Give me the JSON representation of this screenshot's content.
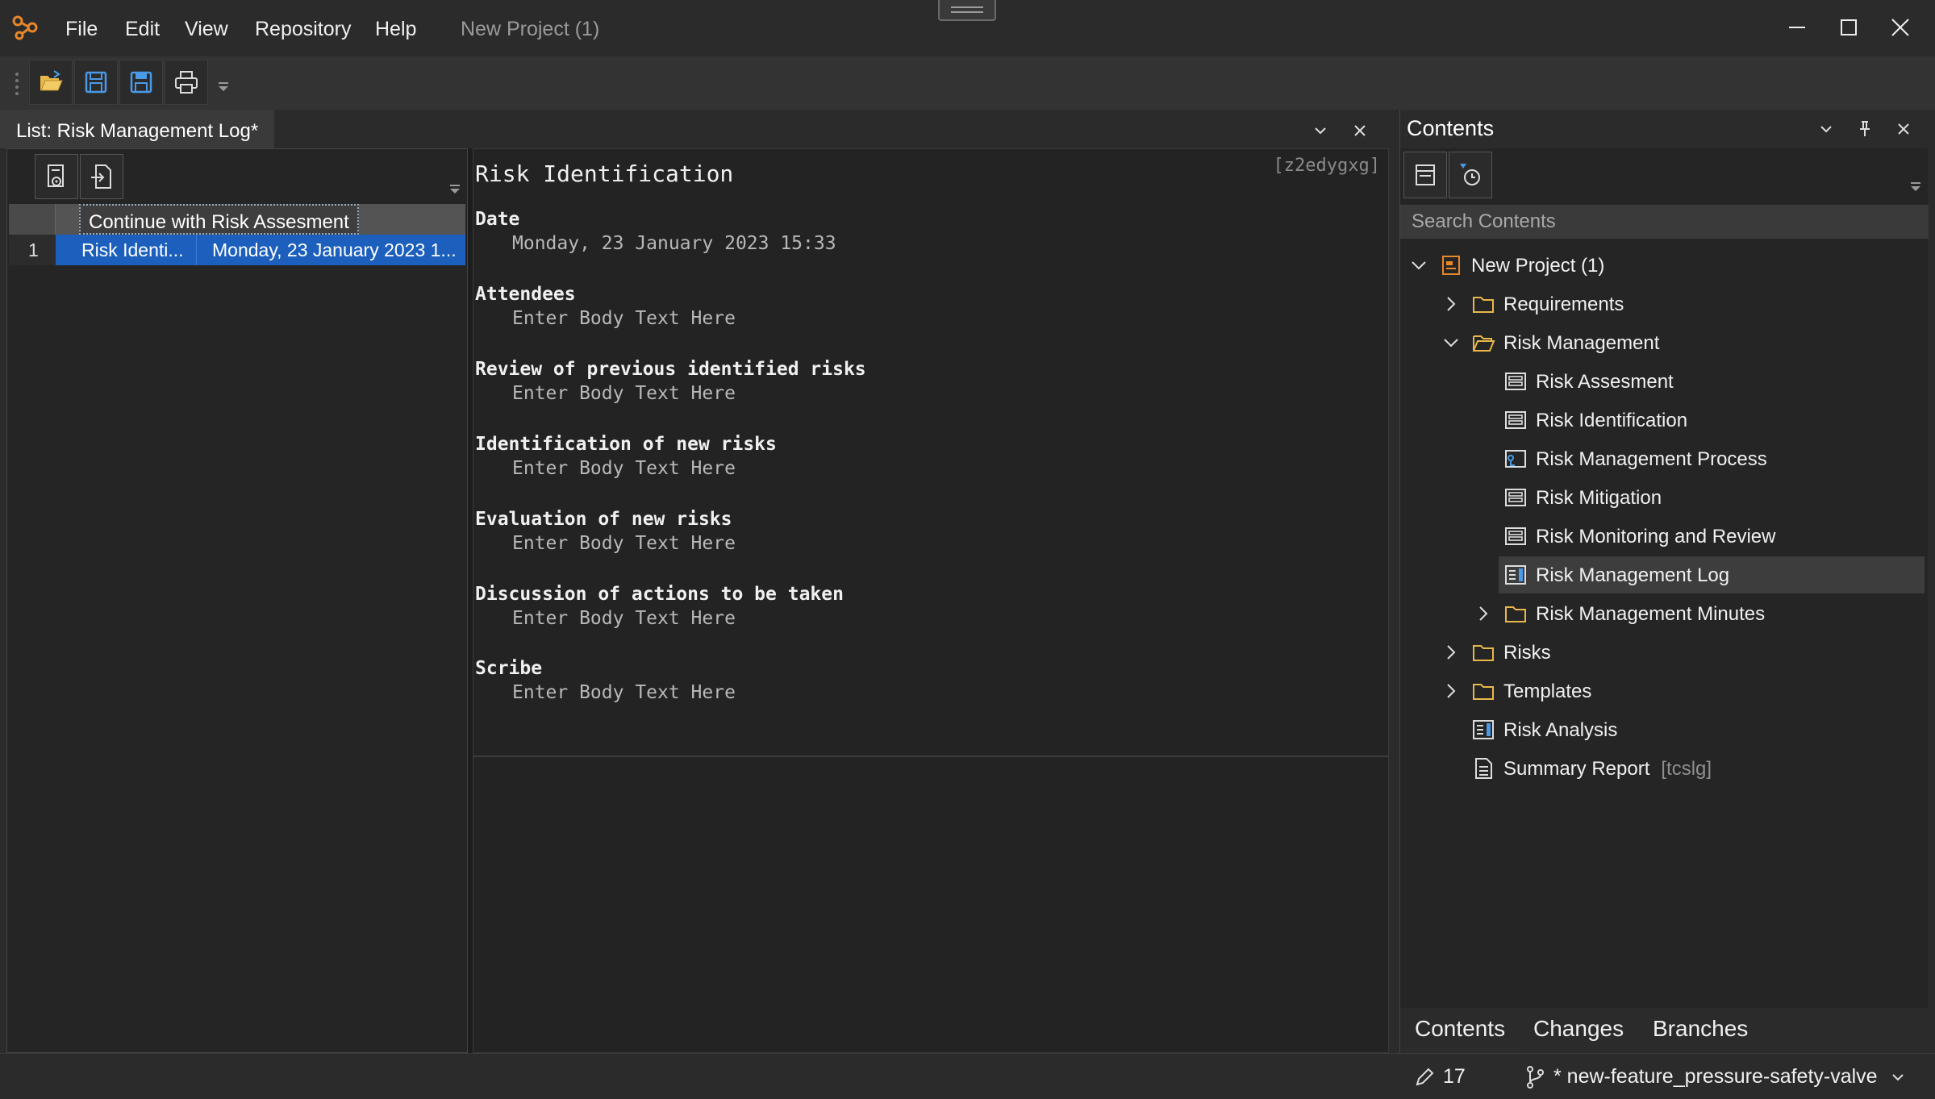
{
  "menu": {
    "items": [
      "File",
      "Edit",
      "View",
      "Repository",
      "Help"
    ],
    "document_title": "New Project (1)"
  },
  "toolbar": {
    "buttons": [
      "open-folder-icon",
      "save-icon",
      "save-all-icon",
      "print-icon"
    ]
  },
  "doc_tab": {
    "label": "List: Risk Management Log*"
  },
  "list_panel": {
    "tooltip": "Continue with Risk Assesment",
    "rows": [
      {
        "num": "1",
        "name": "Risk Identi...",
        "date": "Monday, 23 January 2023 1..."
      }
    ]
  },
  "document": {
    "id_tag": "[z2edygxg]",
    "heading": "Risk Identification",
    "sections": [
      {
        "title": "Date",
        "body": "Monday, 23 January 2023 15:33"
      },
      {
        "title": "Attendees",
        "body": "Enter Body Text Here"
      },
      {
        "title": "Review of previous identified risks",
        "body": "Enter Body Text Here"
      },
      {
        "title": "Identification of new risks",
        "body": "Enter Body Text Here"
      },
      {
        "title": "Evaluation of new risks",
        "body": "Enter Body Text Here"
      },
      {
        "title": "Discussion of actions to be taken",
        "body": "Enter Body Text Here"
      },
      {
        "title": "Scribe",
        "body": "Enter Body Text Here"
      }
    ]
  },
  "contents": {
    "title": "Contents",
    "search_placeholder": "Search Contents",
    "tree": [
      {
        "label": "New Project (1)",
        "depth": 0,
        "expanded": true,
        "icon": "project-icon"
      },
      {
        "label": "Requirements",
        "depth": 1,
        "expanded": false,
        "icon": "folder-icon"
      },
      {
        "label": "Risk Management",
        "depth": 1,
        "expanded": true,
        "icon": "open-folder-icon"
      },
      {
        "label": "Risk Assesment",
        "depth": 2,
        "icon": "form-icon"
      },
      {
        "label": "Risk Identification",
        "depth": 2,
        "icon": "form-icon"
      },
      {
        "label": "Risk Management Process",
        "depth": 2,
        "icon": "process-icon"
      },
      {
        "label": "Risk Mitigation",
        "depth": 2,
        "icon": "form-icon"
      },
      {
        "label": "Risk Monitoring and Review",
        "depth": 2,
        "icon": "form-icon"
      },
      {
        "label": "Risk Management Log",
        "depth": 2,
        "icon": "list-icon",
        "selected": true
      },
      {
        "label": "Risk Management Minutes",
        "depth": 2,
        "expanded": false,
        "icon": "folder-icon"
      },
      {
        "label": "Risks",
        "depth": 1,
        "expanded": false,
        "icon": "folder-icon"
      },
      {
        "label": "Templates",
        "depth": 1,
        "expanded": false,
        "icon": "folder-icon"
      },
      {
        "label": "Risk Analysis",
        "depth": 1,
        "icon": "list-icon"
      },
      {
        "label": "Summary Report",
        "depth": 1,
        "icon": "document-icon",
        "suffix": "[tcslg]"
      }
    ],
    "bottom_tabs": [
      "Contents",
      "Changes",
      "Branches"
    ]
  },
  "status": {
    "edit_count": "17",
    "branch": "* new-feature_pressure-safety-valve"
  }
}
